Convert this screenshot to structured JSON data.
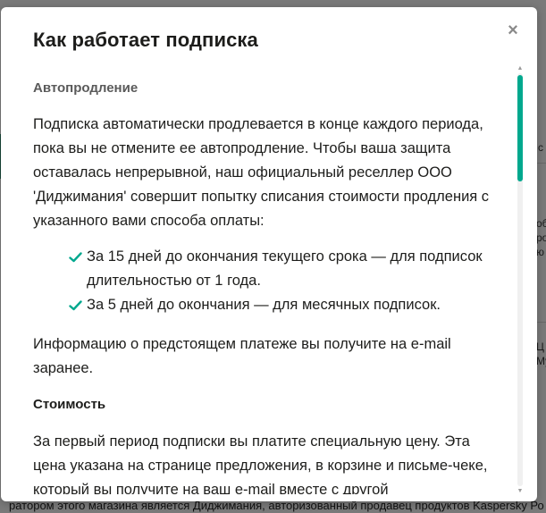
{
  "colors": {
    "accent": "#00a88e",
    "check": "#00a88e",
    "title": "#1d1d1b",
    "overlay": "rgba(0,0,0,0.5)"
  },
  "background": {
    "footer_text": "ратором этого магазина является Диджимания, авторизованный продавец продуктов Kaspersky Ро",
    "right_fragments": [
      "с",
      "об",
      "ро",
      "ю",
      "Ц",
      "Му"
    ]
  },
  "modal": {
    "title": "Как работает подписка",
    "close_label": "×",
    "close_icon": "close-icon",
    "sections": {
      "autorenew_heading": "Автопродление",
      "autorenew_text": "Подписка автоматически продлевается в конце каждого периода, пока вы не отмените ее автопродление. Чтобы ваша защита оставалась непрерывной, наш официальный реселлер ООО 'Диджимания' совершит попытку списания стоимости продления с указанного вами способа оплаты:",
      "items": [
        {
          "icon": "checkmark-icon",
          "text": "За 15 дней до окончания текущего срока — для подписок длительностью от 1 года."
        },
        {
          "icon": "checkmark-icon",
          "text": "За 5 дней до окончания — для месячных подписок."
        }
      ],
      "notice_text": "Информацию о предстоящем платеже вы получите на e-mail заранее.",
      "cost_heading": "Стоимость",
      "cost_text": "За первый период подписки вы платите специальную цену. Эта цена указана на странице предложения, в корзине и письме-чеке, который вы получите на ваш e-mail вместе с другой"
    }
  }
}
